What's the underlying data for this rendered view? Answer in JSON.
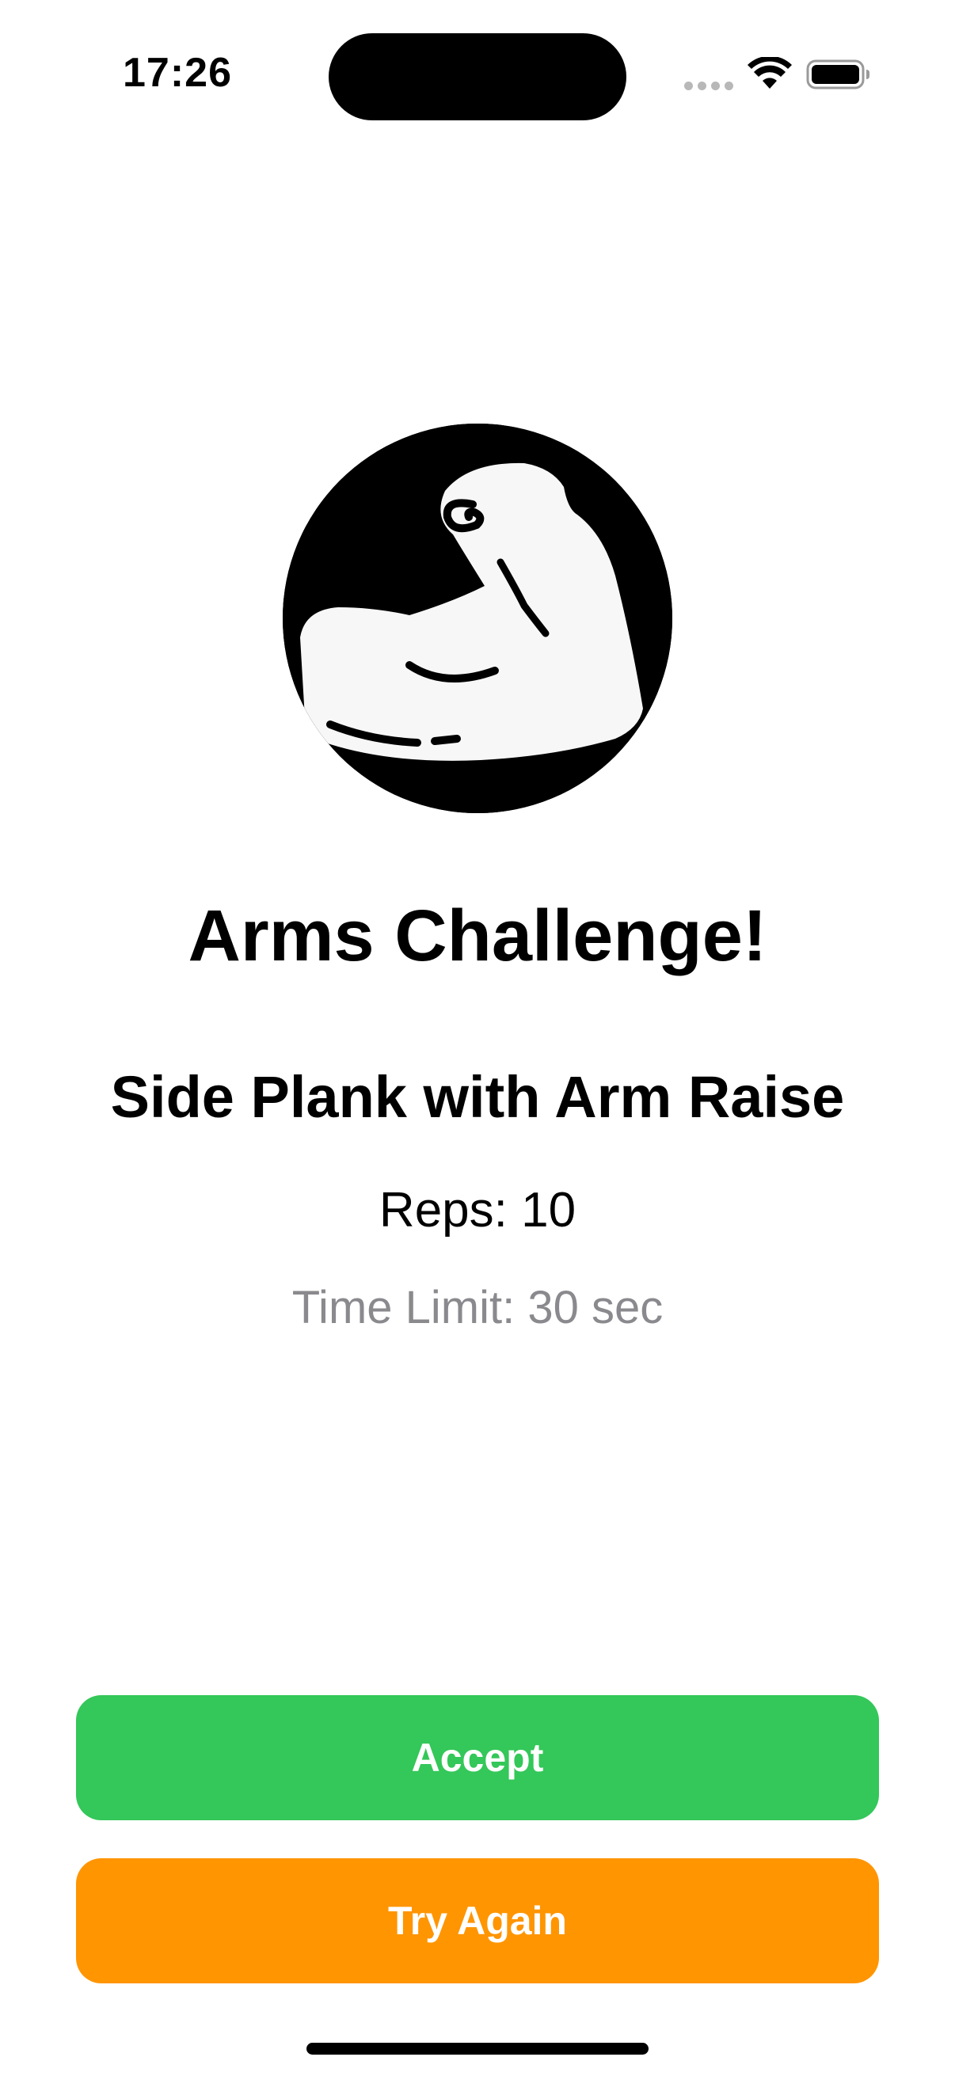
{
  "status_bar": {
    "time": "17:26",
    "icons": [
      "cellular-signal-icon",
      "wifi-icon",
      "battery-icon"
    ]
  },
  "hero": {
    "icon": "flexed-biceps-icon"
  },
  "challenge": {
    "title": "Arms Challenge!",
    "exercise": "Side Plank with Arm Raise",
    "reps": "Reps: 10",
    "time_limit": "Time Limit: 30 sec"
  },
  "actions": {
    "accept_label": "Accept",
    "try_again_label": "Try Again"
  },
  "colors": {
    "accept": "#34C759",
    "try_again": "#FF9500",
    "secondary_text": "#8A8A8E"
  }
}
